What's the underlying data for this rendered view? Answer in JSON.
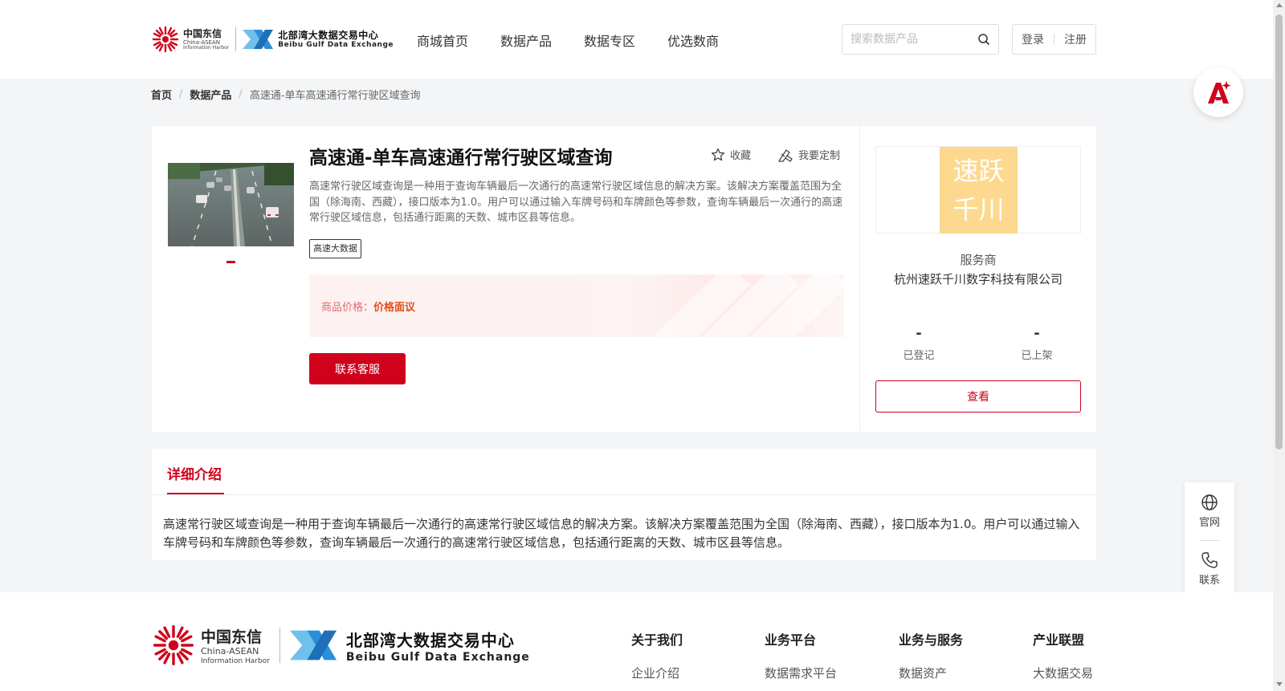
{
  "header": {
    "logo": {
      "chinatelecom_cn": "中国东信",
      "chinatelecom_en1": "China-ASEAN",
      "chinatelecom_en2": "Information Harbor",
      "exchange_cn": "北部湾大数据交易中心",
      "exchange_en": "Beibu Gulf Data Exchange"
    },
    "nav": [
      "商城首页",
      "数据产品",
      "数据专区",
      "优选数商"
    ],
    "search_placeholder": "搜索数据产品",
    "login": "登录",
    "register": "注册"
  },
  "breadcrumb": {
    "home": "首页",
    "category": "数据产品",
    "current": "高速通-单车高速通行常行驶区域查询"
  },
  "product": {
    "title": "高速通-单车高速通行常行驶区域查询",
    "collect": "收藏",
    "customize": "我要定制",
    "description": "高速常行驶区域查询是一种用于查询车辆最后一次通行的高速常行驶区域信息的解决方案。该解决方案覆盖范围为全国（除海南、西藏），接口版本为1.0。用户可以通过输入车牌号码和车牌颜色等参数，查询车辆最后一次通行的高速常行驶区域信息，包括通行距离的天数、城市区县等信息。",
    "tag": "高速大数据",
    "price_label": "商品价格：",
    "price_value": "价格面议",
    "contact_button": "联系客服"
  },
  "provider": {
    "logo_line1": "速跃",
    "logo_line2": "千川",
    "label": "服务商",
    "name": "杭州速跃千川数字科技有限公司",
    "registered_count": "-",
    "registered_label": "已登记",
    "listed_count": "-",
    "listed_label": "已上架",
    "view_button": "查看",
    "logo_bg": "#fcd98f"
  },
  "detail": {
    "tab": "详细介绍",
    "text": "高速常行驶区域查询是一种用于查询车辆最后一次通行的高速常行驶区域信息的解决方案。该解决方案覆盖范围为全国（除海南、西藏），接口版本为1.0。用户可以通过输入车牌号码和车牌颜色等参数，查询车辆最后一次通行的高速常行驶区域信息，包括通行距离的天数、城市区县等信息。"
  },
  "side_tools": {
    "website": "官网",
    "contact": "联系"
  },
  "footer": {
    "columns": [
      {
        "title": "关于我们",
        "link": "企业介绍"
      },
      {
        "title": "业务平台",
        "link": "数据需求平台"
      },
      {
        "title": "业务与服务",
        "link": "数据资产"
      },
      {
        "title": "产业联盟",
        "link": "大数据交易"
      }
    ]
  },
  "colors": {
    "accent": "#d0021b",
    "price": "#e0501c",
    "logo_blue": "#2a8fd8"
  }
}
